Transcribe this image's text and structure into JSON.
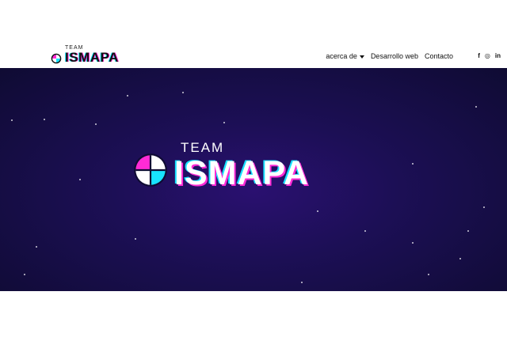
{
  "brand": {
    "team": "TEAM",
    "name": "ISMAPA"
  },
  "nav": {
    "items": [
      {
        "label": "acerca de"
      },
      {
        "label": "Desarrollo web"
      },
      {
        "label": "Contacto"
      }
    ]
  },
  "social": [
    {
      "icon": "facebook-icon",
      "glyph": "f"
    },
    {
      "icon": "instagram-icon",
      "glyph": "◎"
    },
    {
      "icon": "linkedin-icon",
      "glyph": "in"
    }
  ],
  "hero": {
    "team": "TEAM",
    "name": "ISMAPA"
  },
  "colors": {
    "magenta": "#ff2bd6",
    "cyan": "#18e3ff",
    "hero_bg": "#1c0f55"
  }
}
